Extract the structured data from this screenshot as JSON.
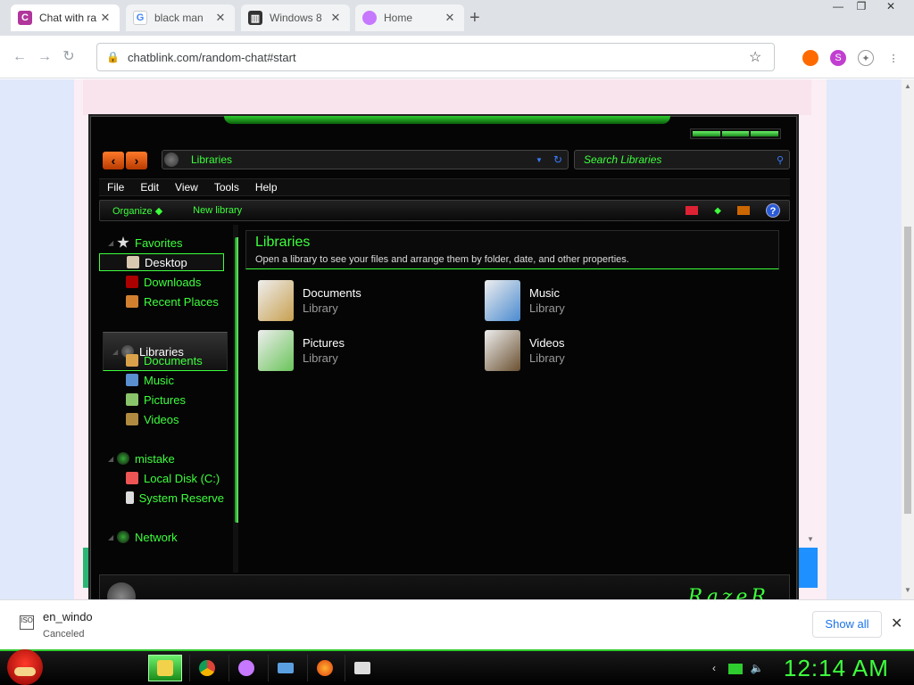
{
  "browser": {
    "tabs": [
      {
        "title": "Chat with ra",
        "active": true,
        "icon": "chatblink-c-icon"
      },
      {
        "title": "black man",
        "active": false,
        "icon": "google-g-icon"
      },
      {
        "title": "Windows 8",
        "active": false,
        "icon": "archive-building-icon"
      },
      {
        "title": "Home",
        "active": false,
        "icon": "tor-onion-icon"
      }
    ],
    "new_tab": "+",
    "window_controls": [
      "—",
      "❐",
      "✕"
    ],
    "nav": {
      "back": "←",
      "forward": "→",
      "reload": "↻"
    },
    "url": "chatblink.com/random-chat#start",
    "lock": "🔒",
    "star": "☆"
  },
  "explorer": {
    "address": "Libraries",
    "search_placeholder": "Search Libraries",
    "menu": [
      "File",
      "Edit",
      "View",
      "Tools",
      "Help"
    ],
    "commands": {
      "organize": "Organize ◆",
      "new_library": "New library"
    },
    "help": "?",
    "nav": {
      "favorites": "Favorites",
      "desktop": "Desktop",
      "downloads": "Downloads",
      "recent": "Recent Places",
      "libraries": "Libraries",
      "documents": "Documents",
      "music": "Music",
      "pictures": "Pictures",
      "videos": "Videos",
      "computer": "mistake",
      "local_disk": "Local Disk (C:)",
      "system_reserved": "System Reserve",
      "network": "Network"
    },
    "content": {
      "title": "Libraries",
      "description": "Open a library to see your files and arrange them by folder, date, and other properties.",
      "items": [
        {
          "name": "Documents",
          "type": "Library"
        },
        {
          "name": "Music",
          "type": "Library"
        },
        {
          "name": "Pictures",
          "type": "Library"
        },
        {
          "name": "Videos",
          "type": "Library"
        }
      ]
    },
    "details_logo": "RazeR"
  },
  "download_shelf": {
    "filename": "en_windo",
    "status": "Canceled",
    "show_all": "Show all",
    "close": "✕"
  },
  "taskbar": {
    "clock": "12:14 AM"
  },
  "colors": {
    "accent_green": "#3dff3d",
    "tab_bar": "#dee1e6",
    "explorer_bg": "#050505"
  }
}
